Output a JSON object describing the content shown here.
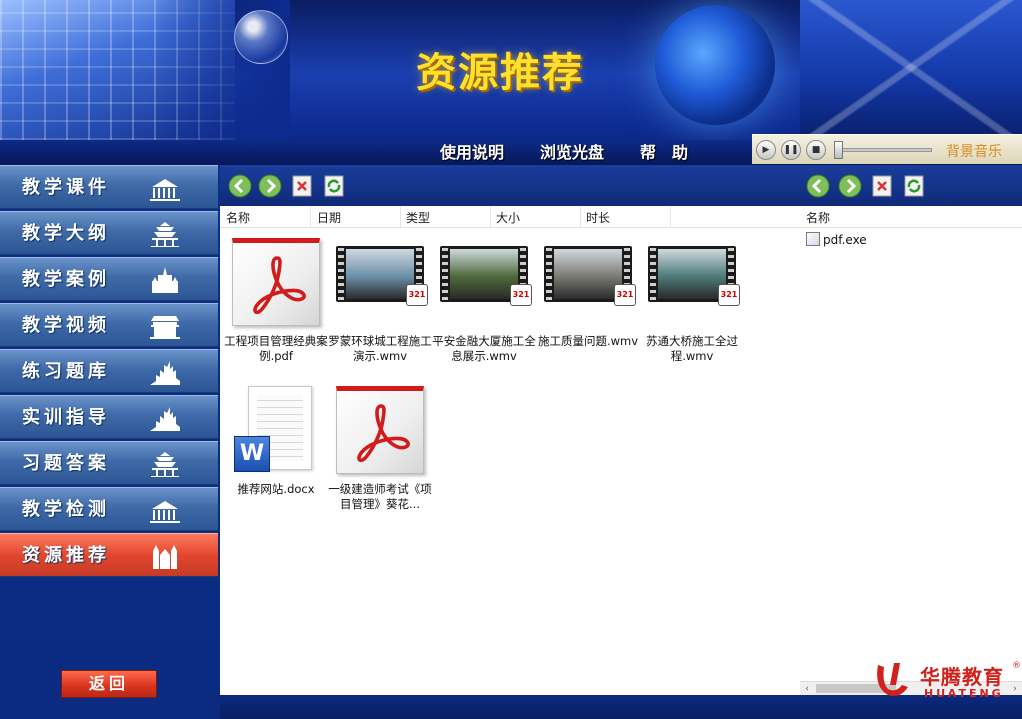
{
  "header": {
    "title": "资源推荐",
    "nav": [
      "使用说明",
      "浏览光盘",
      "帮　助"
    ],
    "music_label": "背景音乐"
  },
  "sidebar": {
    "items": [
      {
        "label": "教学课件",
        "icon": "building-icon"
      },
      {
        "label": "教学大纲",
        "icon": "temple-icon"
      },
      {
        "label": "教学案例",
        "icon": "palace-icon"
      },
      {
        "label": "教学视频",
        "icon": "gate-icon"
      },
      {
        "label": "练习题库",
        "icon": "skyline-icon"
      },
      {
        "label": "实训指导",
        "icon": "skyline-icon"
      },
      {
        "label": "习题答案",
        "icon": "temple-icon"
      },
      {
        "label": "教学检测",
        "icon": "building-icon"
      },
      {
        "label": "资源推荐",
        "icon": "cathedral-icon"
      }
    ],
    "active_index": 8,
    "back_label": "返回"
  },
  "browser": {
    "columns": [
      "名称",
      "日期",
      "类型",
      "大小",
      "时长"
    ],
    "right_column": "名称",
    "files": [
      {
        "name": "工程项目管理经典案例.pdf",
        "kind": "pdf"
      },
      {
        "name": "罗蒙环球城工程施工演示.wmv",
        "kind": "video",
        "color": "#6b8fa8"
      },
      {
        "name": "平安金融大厦施工全息展示.wmv",
        "kind": "video",
        "color": "#4f6a3c"
      },
      {
        "name": "施工质量问题.wmv",
        "kind": "video",
        "color": "#7a7a74"
      },
      {
        "name": "苏通大桥施工全过程.wmv",
        "kind": "video",
        "color": "#4c7a78"
      },
      {
        "name": "推荐网站.docx",
        "kind": "docx"
      },
      {
        "name": "一级建造师考试《项目管理》葵花...",
        "kind": "pdf"
      }
    ],
    "right_files": [
      "pdf.exe"
    ]
  },
  "logo": {
    "cn": "华腾教育",
    "en": "HUATENG",
    "reg": "®"
  }
}
